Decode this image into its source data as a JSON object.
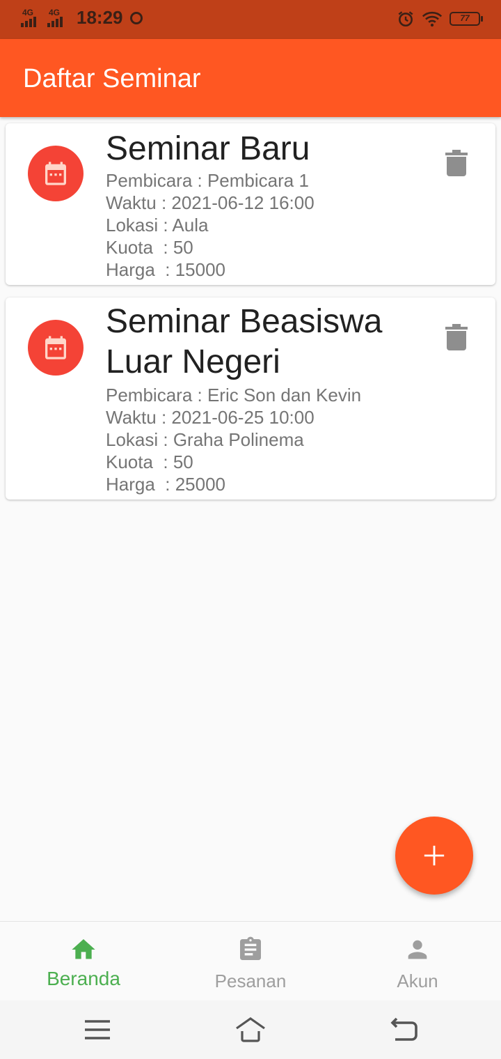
{
  "status_bar": {
    "network_1": "4G",
    "network_2": "4G",
    "time": "18:29",
    "battery": "77",
    "icons": [
      "signal-icon",
      "chrome-icon",
      "alarm-icon",
      "wifi-icon",
      "battery-icon"
    ]
  },
  "app_bar": {
    "title": "Daftar Seminar"
  },
  "seminars": [
    {
      "title": "Seminar Baru",
      "speaker": "Pembicara : Pembicara 1",
      "time": "Waktu : 2021-06-12 16:00",
      "location": "Lokasi : Aula",
      "quota": "Kuota  : 50",
      "price": "Harga  : 15000"
    },
    {
      "title": "Seminar Beasiswa Luar Negeri",
      "speaker": "Pembicara : Eric Son dan Kevin",
      "time": "Waktu : 2021-06-25 10:00",
      "location": "Lokasi : Graha Polinema",
      "quota": "Kuota  : 50",
      "price": "Harga  : 25000"
    }
  ],
  "fab": {
    "icon": "plus-icon"
  },
  "bottom_nav": {
    "items": [
      {
        "label": "Beranda",
        "icon": "home-icon",
        "active": true
      },
      {
        "label": "Pesanan",
        "icon": "clipboard-icon",
        "active": false
      },
      {
        "label": "Akun",
        "icon": "person-icon",
        "active": false
      }
    ]
  },
  "colors": {
    "primary": "#ff5722",
    "status_bar": "#bf4018",
    "avatar": "#f44336",
    "nav_active": "#4caf50",
    "nav_inactive": "#9e9e9e"
  }
}
